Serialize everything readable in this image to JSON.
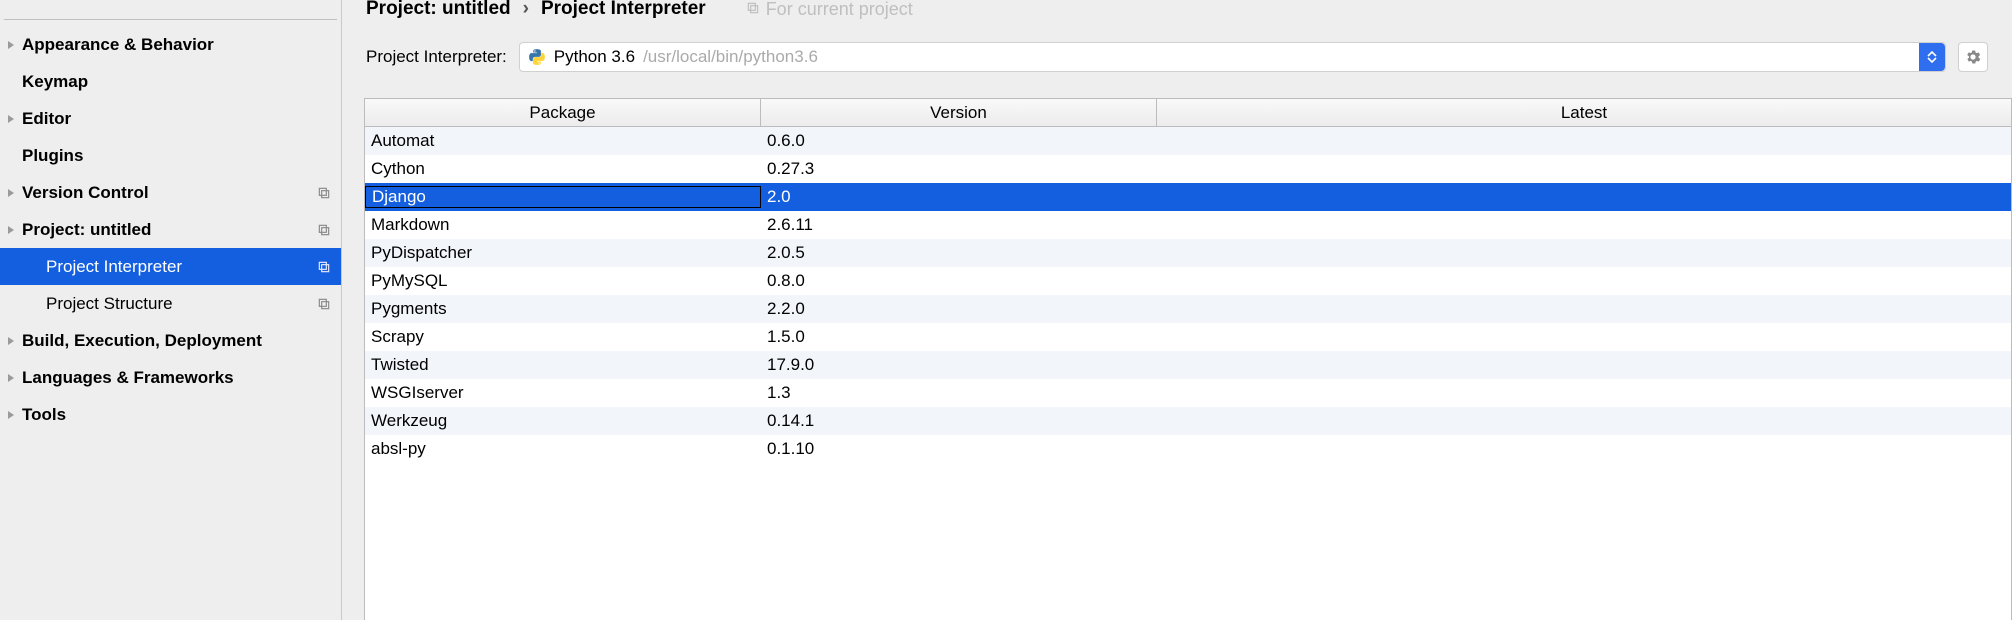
{
  "sidebar": {
    "items": [
      {
        "label": "Appearance & Behavior",
        "bold": true,
        "arrow": true
      },
      {
        "label": "Keymap",
        "bold": true,
        "arrow": false
      },
      {
        "label": "Editor",
        "bold": true,
        "arrow": true
      },
      {
        "label": "Plugins",
        "bold": true,
        "arrow": false
      },
      {
        "label": "Version Control",
        "bold": true,
        "arrow": true,
        "copy": true
      },
      {
        "label": "Project: untitled",
        "bold": true,
        "arrow": true,
        "copy": true
      },
      {
        "label": "Project Interpreter",
        "bold": false,
        "child": true,
        "copy": true,
        "selected": true
      },
      {
        "label": "Project Structure",
        "bold": false,
        "child": true,
        "copy": true
      },
      {
        "label": "Build, Execution, Deployment",
        "bold": true,
        "arrow": true
      },
      {
        "label": "Languages & Frameworks",
        "bold": true,
        "arrow": true
      },
      {
        "label": "Tools",
        "bold": true,
        "arrow": true
      }
    ]
  },
  "breadcrumb": {
    "project": "Project: untitled",
    "section": "Project Interpreter",
    "meta": "For current project"
  },
  "interpreter": {
    "label": "Project Interpreter:",
    "name": "Python 3.6",
    "path": "/usr/local/bin/python3.6"
  },
  "table": {
    "headers": {
      "package": "Package",
      "version": "Version",
      "latest": "Latest"
    },
    "rows": [
      {
        "package": "Automat",
        "version": "0.6.0",
        "latest": ""
      },
      {
        "package": "Cython",
        "version": "0.27.3",
        "latest": ""
      },
      {
        "package": "Django",
        "version": "2.0",
        "latest": "",
        "selected": true
      },
      {
        "package": "Markdown",
        "version": "2.6.11",
        "latest": ""
      },
      {
        "package": "PyDispatcher",
        "version": "2.0.5",
        "latest": ""
      },
      {
        "package": "PyMySQL",
        "version": "0.8.0",
        "latest": ""
      },
      {
        "package": "Pygments",
        "version": "2.2.0",
        "latest": ""
      },
      {
        "package": "Scrapy",
        "version": "1.5.0",
        "latest": ""
      },
      {
        "package": "Twisted",
        "version": "17.9.0",
        "latest": ""
      },
      {
        "package": "WSGIserver",
        "version": "1.3",
        "latest": ""
      },
      {
        "package": "Werkzeug",
        "version": "0.14.1",
        "latest": ""
      },
      {
        "package": "absl-py",
        "version": "0.1.10",
        "latest": ""
      }
    ]
  }
}
